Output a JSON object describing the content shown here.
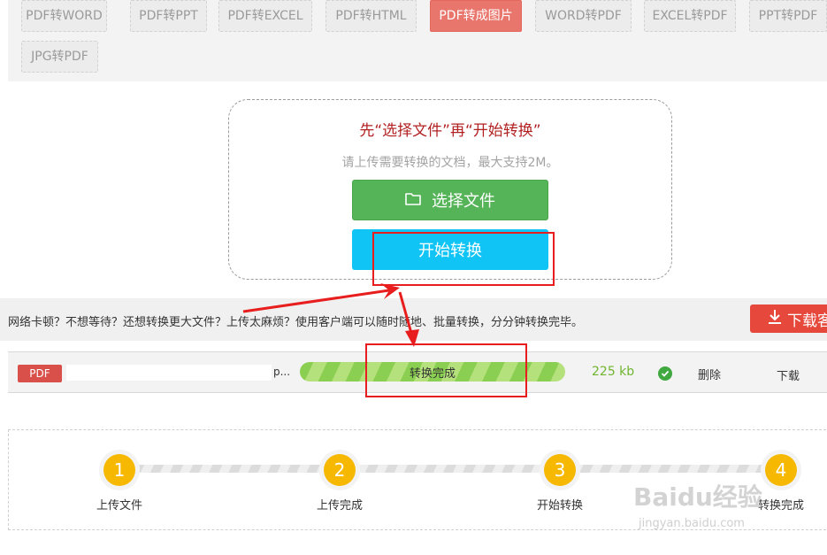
{
  "tabs": [
    {
      "label": "PDF转WORD",
      "active": false
    },
    {
      "label": "PDF转PPT",
      "active": false
    },
    {
      "label": "PDF转EXCEL",
      "active": false
    },
    {
      "label": "PDF转HTML",
      "active": false
    },
    {
      "label": "PDF转成图片",
      "active": true
    },
    {
      "label": "WORD转PDF",
      "active": false
    },
    {
      "label": "EXCEL转PDF",
      "active": false
    },
    {
      "label": "PPT转PDF",
      "active": false
    },
    {
      "label": "JPG转PDF",
      "active": false
    }
  ],
  "upload": {
    "title": "先“选择文件”再“开始转换”",
    "hint": "请上传需要转换的文档，最大支持2M。",
    "choose_label": "选择文件",
    "convert_label": "开始转换"
  },
  "notice": {
    "text": "网络卡顿？不想等待？还想转换更大文件？上传太麻烦？使用客户端可以随时随地、批量转换，分分钟转换完毕。",
    "download_label": "下载客"
  },
  "file": {
    "badge": "PDF",
    "name_tail": "p...",
    "progress_label": "转换完成",
    "progress": 1.0,
    "size": "225 kb",
    "delete_label": "删除",
    "download_label": "下载"
  },
  "steps": [
    {
      "num": "1",
      "label": "上传文件"
    },
    {
      "num": "2",
      "label": "上传完成"
    },
    {
      "num": "3",
      "label": "开始转换"
    },
    {
      "num": "4",
      "label": "转换完成"
    }
  ],
  "watermark": {
    "logo": "Baidu经验",
    "url": "jingyan.baidu.com"
  },
  "colors": {
    "active_tab": "#e9766c",
    "choose_button": "#55b358",
    "convert_button": "#10c4f5",
    "annotation": "#e81d1d",
    "step": "#f6b800"
  }
}
